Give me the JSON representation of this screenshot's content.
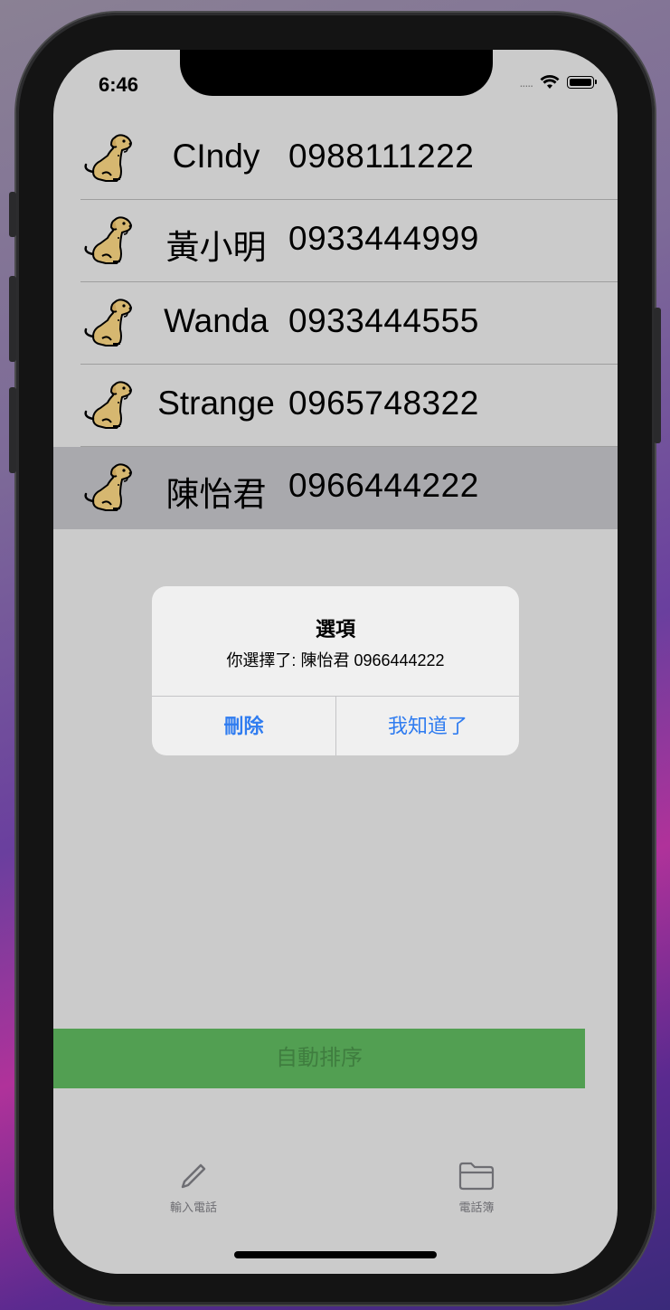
{
  "status_bar": {
    "time": "6:46",
    "signal": "....."
  },
  "contacts": [
    {
      "name": "CIndy",
      "phone": "0988111222",
      "selected": false
    },
    {
      "name": "黃小明",
      "phone": "0933444999",
      "selected": false
    },
    {
      "name": "Wanda",
      "phone": "0933444555",
      "selected": false
    },
    {
      "name": "Strange",
      "phone": "0965748322",
      "selected": false
    },
    {
      "name": "陳怡君",
      "phone": "0966444222",
      "selected": true
    }
  ],
  "alert": {
    "title": "選項",
    "message": "你選擇了: 陳怡君 0966444222",
    "delete_label": "刪除",
    "ok_label": "我知道了"
  },
  "sort_button": {
    "label": "自動排序"
  },
  "tabbar": {
    "input_label": "輸入電話",
    "phonebook_label": "電話簿"
  },
  "colors": {
    "accent": "#2f7cf0",
    "sort_button_bg": "#529f52",
    "selected_row": "#a9a9ad"
  }
}
